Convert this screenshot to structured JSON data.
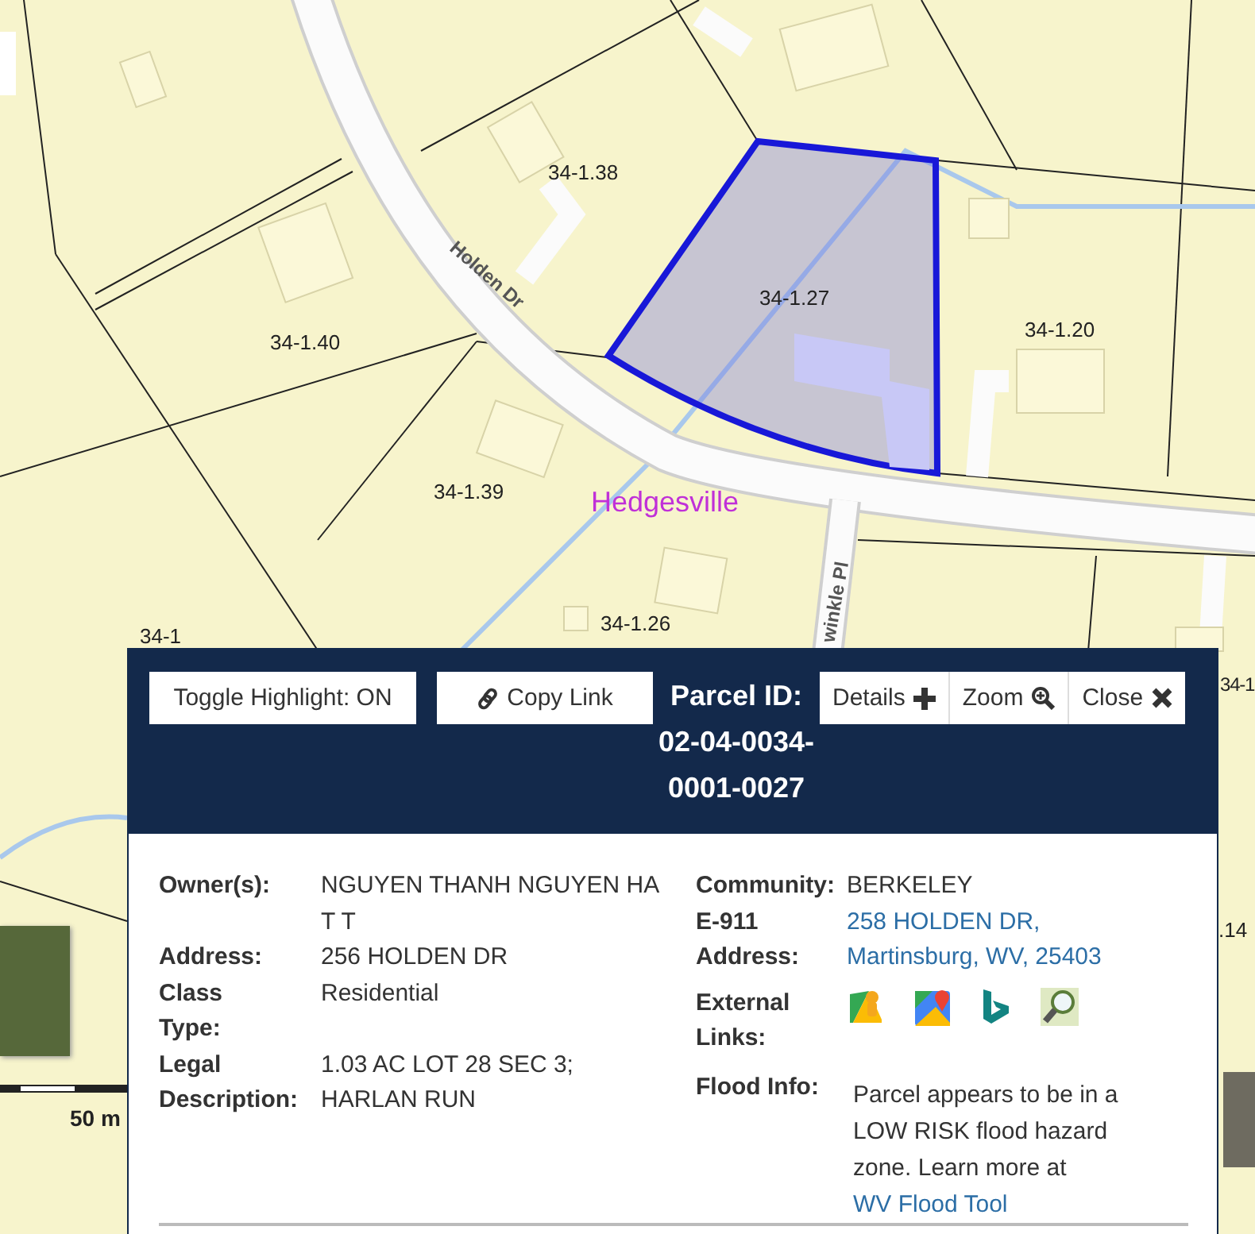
{
  "map": {
    "labels": [
      {
        "kind": "parcel",
        "text": "34-1.38"
      },
      {
        "kind": "parcel",
        "text": "34-1.27"
      },
      {
        "kind": "parcel",
        "text": "34-1.40"
      },
      {
        "kind": "parcel",
        "text": "34-1.20"
      },
      {
        "kind": "parcel",
        "text": "34-1.39"
      },
      {
        "kind": "parcel",
        "text": "34-1.26"
      },
      {
        "kind": "parcel",
        "text": "34-1"
      },
      {
        "kind": "parcel",
        "text": "34-1"
      },
      {
        "kind": "parcel",
        "text": ".14"
      },
      {
        "kind": "street",
        "text": "Holden Dr"
      },
      {
        "kind": "street",
        "text": "winkle Pl"
      },
      {
        "kind": "place",
        "text": "Hedgesville"
      }
    ],
    "scale": "50 m"
  },
  "popup": {
    "toggle_button": "Toggle Highlight: ON",
    "copy_button": "Copy Link",
    "title": "Parcel ID:",
    "parcel_id": "02-04-0034-0001-0027",
    "actions": [
      {
        "kind": "plus",
        "label": "Details"
      },
      {
        "kind": "zoom",
        "label": "Zoom"
      },
      {
        "kind": "close",
        "label": "Close"
      }
    ],
    "left_fields": [
      {
        "label": "Owner(s):",
        "value": "NGUYEN THANH NGUYEN HA T T"
      },
      {
        "label": "Address:",
        "value": "256 HOLDEN DR"
      },
      {
        "label": "Class Type:",
        "value": "Residential"
      },
      {
        "label": "Legal Description:",
        "value": "1.03 AC LOT 28 SEC 3; HARLAN RUN"
      }
    ],
    "community": {
      "label": "Community:",
      "value": "BERKELEY"
    },
    "e911": {
      "label": "E-911 Address:",
      "link": "258 HOLDEN DR, Martinsburg, WV, 25403"
    },
    "external": {
      "label": "External Links:",
      "links": [
        {
          "kind": "streetview"
        },
        {
          "kind": "maps"
        },
        {
          "kind": "bing"
        },
        {
          "kind": "magnifier"
        }
      ]
    },
    "flood": {
      "label": "Flood Info:",
      "text": "Parcel appears to be in a LOW RISK flood hazard zone. Learn more at",
      "link": "WV Flood Tool"
    }
  }
}
